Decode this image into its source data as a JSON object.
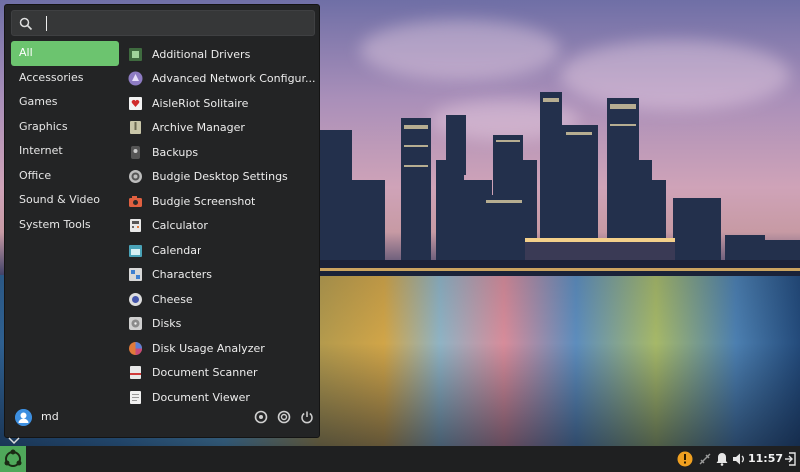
{
  "search": {
    "value": "",
    "placeholder": ""
  },
  "categories": [
    {
      "label": "All",
      "active": true
    },
    {
      "label": "Accessories"
    },
    {
      "label": "Games"
    },
    {
      "label": "Graphics"
    },
    {
      "label": "Internet"
    },
    {
      "label": "Office"
    },
    {
      "label": "Sound & Video"
    },
    {
      "label": "System Tools"
    }
  ],
  "apps": [
    {
      "label": "Additional Drivers",
      "icon": "chip-icon",
      "color": "#5f8f5a"
    },
    {
      "label": "Advanced Network Configur...",
      "icon": "network-icon",
      "color": "#8e7cc3"
    },
    {
      "label": "AisleRiot Solitaire",
      "icon": "cards-icon",
      "color": "#f2f2f2"
    },
    {
      "label": "Archive Manager",
      "icon": "archive-icon",
      "color": "#b8b8a0"
    },
    {
      "label": "Backups",
      "icon": "backup-icon",
      "color": "#444444"
    },
    {
      "label": "Budgie Desktop Settings",
      "icon": "settings-icon",
      "color": "#9a9a9a"
    },
    {
      "label": "Budgie Screenshot",
      "icon": "camera-icon",
      "color": "#e06040"
    },
    {
      "label": "Calculator",
      "icon": "calculator-icon",
      "color": "#e8e8e8"
    },
    {
      "label": "Calendar",
      "icon": "calendar-icon",
      "color": "#4aa3b8"
    },
    {
      "label": "Characters",
      "icon": "characters-icon",
      "color": "#d8d8d8"
    },
    {
      "label": "Cheese",
      "icon": "webcam-icon",
      "color": "#dcdcdc"
    },
    {
      "label": "Disks",
      "icon": "disk-icon",
      "color": "#cfcfcf"
    },
    {
      "label": "Disk Usage Analyzer",
      "icon": "pie-chart-icon",
      "color": "#e07a3a"
    },
    {
      "label": "Document Scanner",
      "icon": "scanner-icon",
      "color": "#e8e8e8"
    },
    {
      "label": "Document Viewer",
      "icon": "document-icon",
      "color": "#f0f0f0"
    }
  ],
  "user": {
    "name": "md"
  },
  "clock": "11:57",
  "colors": {
    "accent": "#6cc46f",
    "panel": "#232425",
    "taskbar": "#1f2021",
    "launcher": "#4fa85a",
    "warning": "#f0a020"
  }
}
